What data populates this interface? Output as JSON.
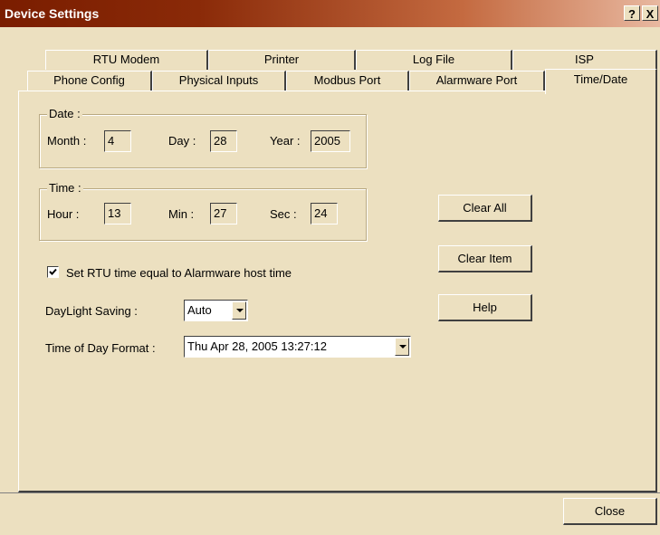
{
  "window": {
    "title": "Device Settings",
    "help_glyph": "?",
    "close_glyph": "X"
  },
  "tabs_back": [
    "RTU Modem",
    "Printer",
    "Log File",
    "ISP"
  ],
  "tabs_front": [
    "Phone Config",
    "Physical Inputs",
    "Modbus Port",
    "Alarmware Port",
    "Time/Date"
  ],
  "selected_tab": "Time/Date",
  "date_group": {
    "label": "Date :",
    "month_label": "Month :",
    "month_value": "4",
    "day_label": "Day :",
    "day_value": "28",
    "year_label": "Year :",
    "year_value": "2005"
  },
  "time_group": {
    "label": "Time :",
    "hour_label": "Hour :",
    "hour_value": "13",
    "min_label": "Min :",
    "min_value": "27",
    "sec_label": "Sec :",
    "sec_value": "24"
  },
  "sync_checkbox": {
    "label": "Set RTU time equal to Alarmware host time",
    "checked": true
  },
  "daylight": {
    "label": "DayLight Saving :",
    "value": "Auto"
  },
  "time_format": {
    "label": "Time of Day Format :",
    "value": "Thu Apr 28, 2005 13:27:12"
  },
  "buttons": {
    "clear_all": "Clear All",
    "clear_item": "Clear Item",
    "help": "Help",
    "close": "Close"
  },
  "colors": {
    "dialog_bg": "#ece0c0",
    "title_start": "#7a1d00",
    "title_end": "#e8b8a0"
  }
}
